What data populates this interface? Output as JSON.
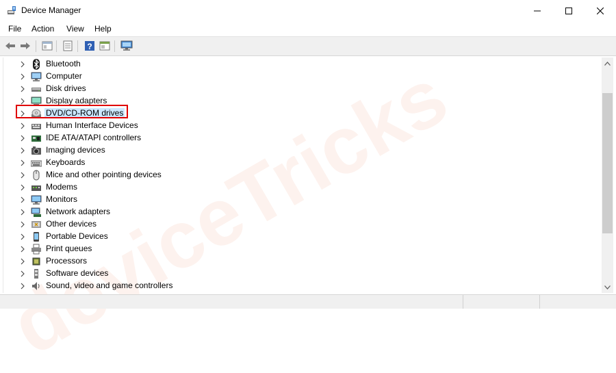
{
  "window": {
    "title": "Device Manager"
  },
  "menu": [
    {
      "label": "File"
    },
    {
      "label": "Action"
    },
    {
      "label": "View"
    },
    {
      "label": "Help"
    }
  ],
  "toolbar": [
    "back-icon",
    "forward-icon",
    "properties-pane-icon",
    "list-view-icon",
    "help-icon",
    "update-view-icon",
    "monitor-scan-icon"
  ],
  "tree": {
    "items": [
      {
        "label": "Bluetooth",
        "icon": "bluetooth-icon"
      },
      {
        "label": "Computer",
        "icon": "computer-icon"
      },
      {
        "label": "Disk drives",
        "icon": "disk-drive-icon"
      },
      {
        "label": "Display adapters",
        "icon": "display-adapter-icon"
      },
      {
        "label": "DVD/CD-ROM drives",
        "icon": "dvd-drive-icon",
        "selected": true,
        "highlighted": true
      },
      {
        "label": "Human Interface Devices",
        "icon": "hid-icon"
      },
      {
        "label": "IDE ATA/ATAPI controllers",
        "icon": "ide-controller-icon"
      },
      {
        "label": "Imaging devices",
        "icon": "camera-icon"
      },
      {
        "label": "Keyboards",
        "icon": "keyboard-icon"
      },
      {
        "label": "Mice and other pointing devices",
        "icon": "mouse-icon"
      },
      {
        "label": "Modems",
        "icon": "modem-icon"
      },
      {
        "label": "Monitors",
        "icon": "monitor-icon"
      },
      {
        "label": "Network adapters",
        "icon": "network-adapter-icon"
      },
      {
        "label": "Other devices",
        "icon": "other-device-icon"
      },
      {
        "label": "Portable Devices",
        "icon": "portable-device-icon"
      },
      {
        "label": "Print queues",
        "icon": "printer-icon"
      },
      {
        "label": "Processors",
        "icon": "processor-icon"
      },
      {
        "label": "Software devices",
        "icon": "software-device-icon"
      },
      {
        "label": "Sound, video and game controllers",
        "icon": "speaker-icon"
      }
    ]
  },
  "watermark": "deviceTricks",
  "colors": {
    "selection": "#cce8ff",
    "highlight_border": "#e00000",
    "toolbar_bg": "#f0f0f0"
  }
}
